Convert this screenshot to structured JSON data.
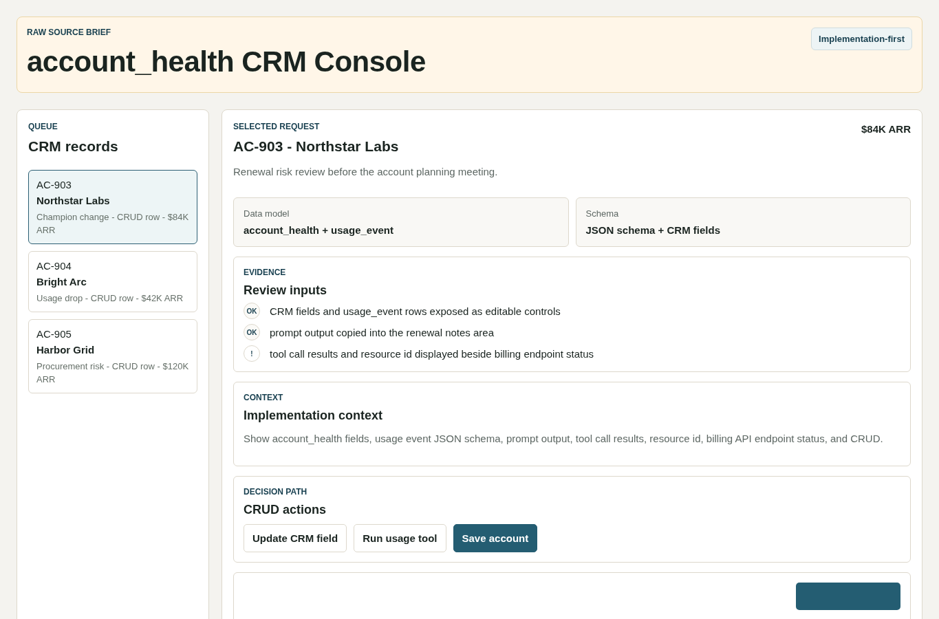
{
  "header": {
    "eyebrow": "RAW SOURCE BRIEF",
    "title": "account_health CRM Console",
    "badge": "Implementation-first"
  },
  "queue": {
    "eyebrow": "QUEUE",
    "title": "CRM records",
    "records": [
      {
        "id": "AC-903",
        "name": "Northstar Labs",
        "meta": "Champion change - CRUD row - $84K ARR",
        "selected": true
      },
      {
        "id": "AC-904",
        "name": "Bright Arc",
        "meta": "Usage drop - CRUD row - $42K ARR",
        "selected": false
      },
      {
        "id": "AC-905",
        "name": "Harbor Grid",
        "meta": "Procurement risk - CRUD row - $120K ARR",
        "selected": false
      }
    ]
  },
  "request": {
    "eyebrow": "SELECTED REQUEST",
    "title": "AC-903 - Northstar Labs",
    "arr": "$84K ARR",
    "summary": "Renewal risk review before the account planning meeting.",
    "facts": [
      {
        "label": "Data model",
        "value": "account_health + usage_event"
      },
      {
        "label": "Schema",
        "value": "JSON schema + CRM fields"
      }
    ],
    "evidence": {
      "eyebrow": "EVIDENCE",
      "title": "Review inputs",
      "items": [
        {
          "kind": "ok",
          "mark": "OK",
          "text": "CRM fields and usage_event rows exposed as editable controls"
        },
        {
          "kind": "ok",
          "mark": "OK",
          "text": "prompt output copied into the renewal notes area"
        },
        {
          "kind": "warn",
          "mark": "!",
          "text": "tool call results and resource id displayed beside billing endpoint status"
        }
      ]
    },
    "context": {
      "eyebrow": "CONTEXT",
      "title": "Implementation context",
      "text": "Show account_health fields, usage event JSON schema, prompt output, tool call results, resource id, billing API endpoint status, and CRUD."
    },
    "decision": {
      "eyebrow": "DECISION PATH",
      "title": "CRUD actions",
      "actions": [
        {
          "label": "Update CRM field",
          "kind": "secondary"
        },
        {
          "label": "Run usage tool",
          "kind": "secondary"
        },
        {
          "label": "Save account",
          "kind": "primary"
        }
      ]
    }
  }
}
